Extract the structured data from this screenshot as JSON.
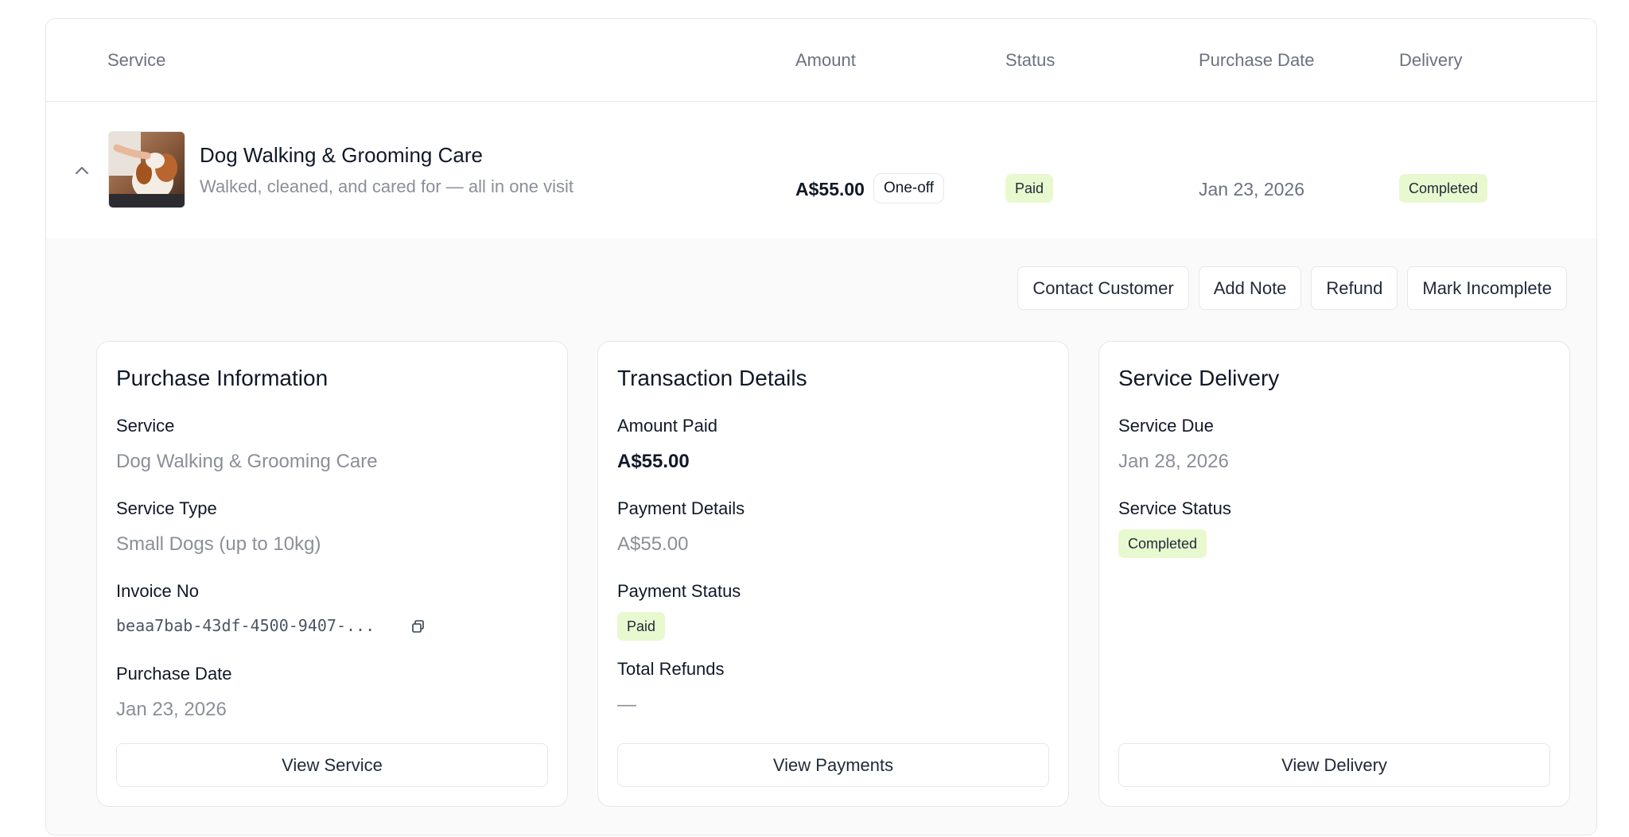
{
  "table": {
    "headers": {
      "service": "Service",
      "amount": "Amount",
      "status": "Status",
      "purchase_date": "Purchase Date",
      "delivery": "Delivery"
    },
    "row": {
      "expand_icon": "chevron-up-icon",
      "thumbnail": "dog-grooming-photo",
      "title": "Dog Walking & Grooming Care",
      "subtitle": "Walked, cleaned, and cared for — all in one visit",
      "amount": "A$55.00",
      "frequency": "One-off",
      "status": "Paid",
      "purchase_date": "Jan 23, 2026",
      "delivery": "Completed"
    }
  },
  "actions": [
    "Contact Customer",
    "Add Note",
    "Refund",
    "Mark Incomplete"
  ],
  "purchase_info": {
    "title": "Purchase Information",
    "service_label": "Service",
    "service_value": "Dog Walking & Grooming Care",
    "type_label": "Service Type",
    "type_value": "Small Dogs (up to 10kg)",
    "invoice_label": "Invoice No",
    "invoice_value": "beaa7bab-43df-4500-9407-...",
    "copy_icon": "copy-icon",
    "date_label": "Purchase Date",
    "date_value": "Jan 23, 2026",
    "button": "View Service"
  },
  "transaction": {
    "title": "Transaction Details",
    "amount_label": "Amount Paid",
    "amount_value": "A$55.00",
    "details_label": "Payment Details",
    "details_value": "A$55.00",
    "status_label": "Payment Status",
    "status_value": "Paid",
    "refunds_label": "Total Refunds",
    "refunds_value": "—",
    "button": "View Payments"
  },
  "delivery": {
    "title": "Service Delivery",
    "due_label": "Service Due",
    "due_value": "Jan 28, 2026",
    "status_label": "Service Status",
    "status_value": "Completed",
    "button": "View Delivery"
  },
  "colors": {
    "badge_bg": "#e9f9cf",
    "border": "#e5e7eb",
    "muted_text": "#6b7280",
    "expanded_bg": "#fafafa"
  }
}
